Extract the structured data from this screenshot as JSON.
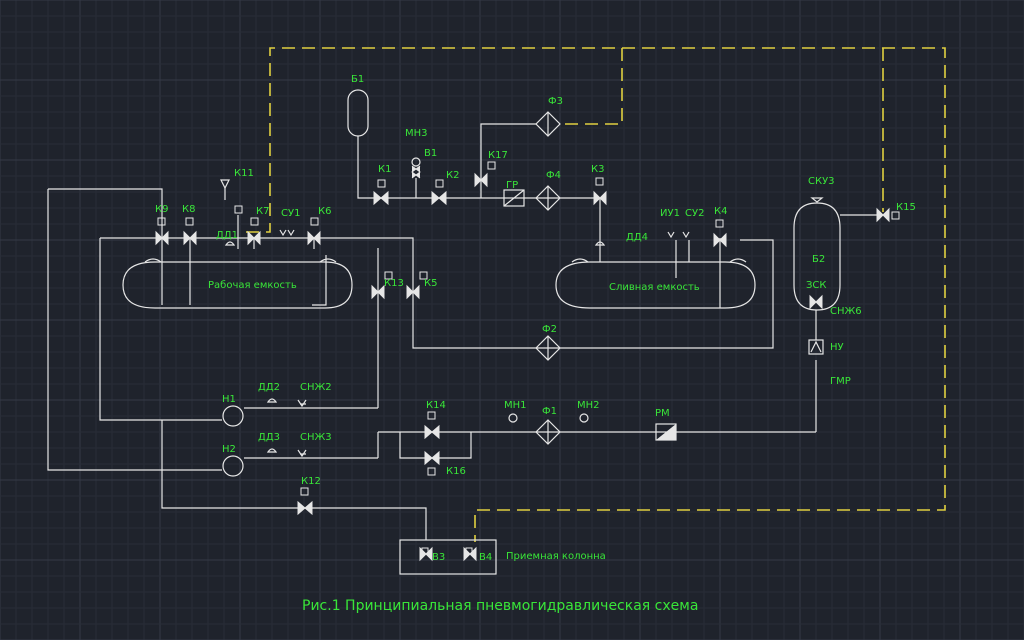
{
  "caption": "Рис.1 Принципиальная пневмогидравлическая схема",
  "vessels": {
    "work": "Рабочая емкость",
    "drain": "Сливная емкость",
    "receiver": "Приемная колонна"
  },
  "labels": {
    "b1": "Б1",
    "b2": "Б2",
    "mn3": "МН3",
    "v1": "В1",
    "k1": "К1",
    "k2": "К2",
    "k17": "К17",
    "f3": "Ф3",
    "f4": "Ф4",
    "gr": "ГР",
    "k3": "К3",
    "k11": "К11",
    "k9": "К9",
    "k8": "К8",
    "k7": "К7",
    "dd1": "ДД1",
    "su1": "СУ1",
    "k6": "К6",
    "iu1": "ИУ1",
    "su2": "СУ2",
    "k4": "К4",
    "dd4": "ДД4",
    "skuz": "СКУ3",
    "k15": "К15",
    "zsk": "ЗСК",
    "snzh6": "СНЖ6",
    "nu": "НУ",
    "gmr": "ГМР",
    "k13": "К13",
    "k5": "К5",
    "f2": "Ф2",
    "n1": "Н1",
    "dd2": "ДД2",
    "snzh2": "СНЖ2",
    "n2": "Н2",
    "dd3": "ДД3",
    "snzh3": "СНЖ3",
    "k14": "К14",
    "k16": "К16",
    "mn1": "МН1",
    "f1": "Ф1",
    "mn2": "МН2",
    "rm": "РМ",
    "k12": "К12",
    "v3": "В3",
    "v4": "В4"
  }
}
